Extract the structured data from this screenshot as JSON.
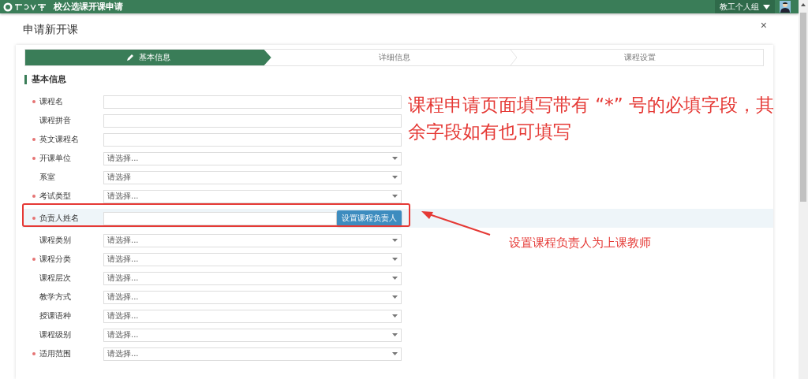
{
  "top_bar": {
    "title": "校公选课开课申请",
    "user_menu": "教工个人组"
  },
  "dialog": {
    "title": "申请新开课",
    "close": "×"
  },
  "steps": [
    {
      "label": "基本信息",
      "selected": true
    },
    {
      "label": "详细信息",
      "selected": false
    },
    {
      "label": "课程设置",
      "selected": false
    }
  ],
  "section": {
    "title": "基本信息"
  },
  "fields": [
    {
      "label": "课程名",
      "required": true,
      "kind": "text",
      "highlighted": false
    },
    {
      "label": "课程拼音",
      "required": false,
      "kind": "text",
      "highlighted": false
    },
    {
      "label": "英文课程名",
      "required": true,
      "kind": "text",
      "highlighted": false
    },
    {
      "label": "开课单位",
      "required": true,
      "kind": "select",
      "value": "请选择...",
      "highlighted": false
    },
    {
      "label": "系室",
      "required": false,
      "kind": "select",
      "value": "请选择",
      "highlighted": false
    },
    {
      "label": "考试类型",
      "required": true,
      "kind": "select",
      "value": "请选择...",
      "highlighted": false
    },
    {
      "label": "负责人姓名",
      "required": true,
      "kind": "text_button",
      "button": "设置课程负责人",
      "highlighted": true
    },
    {
      "label": "课程类别",
      "required": false,
      "kind": "select",
      "value": "请选择...",
      "highlighted": false
    },
    {
      "label": "课程分类",
      "required": true,
      "kind": "select",
      "value": "请选择...",
      "highlighted": false
    },
    {
      "label": "课程层次",
      "required": false,
      "kind": "select",
      "value": "请选择...",
      "highlighted": false
    },
    {
      "label": "教学方式",
      "required": false,
      "kind": "select",
      "value": "请选择...",
      "highlighted": false
    },
    {
      "label": "授课语种",
      "required": false,
      "kind": "select",
      "value": "请选择...",
      "highlighted": false
    },
    {
      "label": "课程级别",
      "required": false,
      "kind": "select",
      "value": "请选择...",
      "highlighted": false
    },
    {
      "label": "适用范围",
      "required": true,
      "kind": "select",
      "value": "请选择...",
      "highlighted": false
    }
  ],
  "annotations": [
    {
      "text": "课程申请页面填写带有 “*” 号的必填字段，其余字段如有也可填写",
      "kind": "large"
    },
    {
      "text": "设置课程负责人为上课教师",
      "kind": "small"
    }
  ]
}
